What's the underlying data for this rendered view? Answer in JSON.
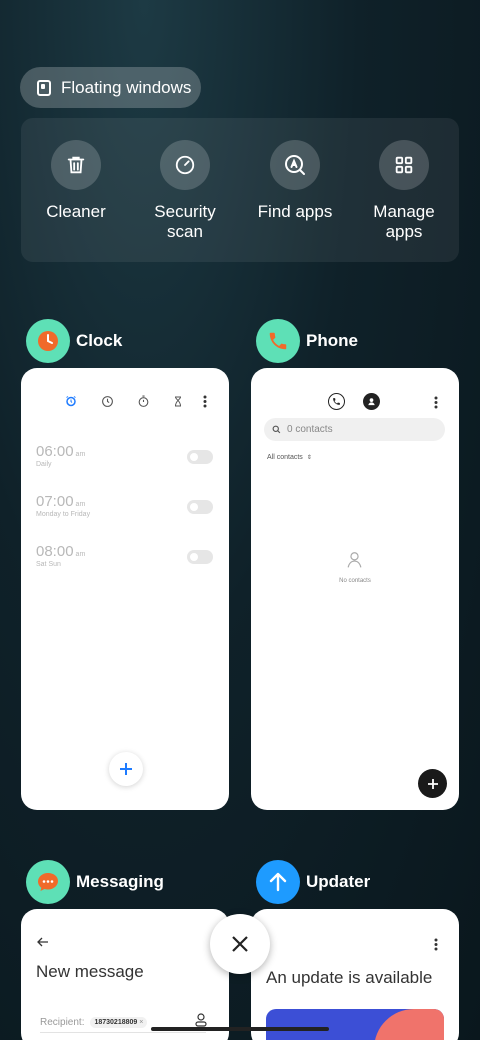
{
  "floating_windows": {
    "label": "Floating windows"
  },
  "quick_actions": [
    {
      "label": "Cleaner",
      "icon": "trash-icon"
    },
    {
      "label": "Security scan",
      "icon": "gauge-icon"
    },
    {
      "label": "Find apps",
      "icon": "find-apps-icon"
    },
    {
      "label": "Manage apps",
      "icon": "grid-icon"
    }
  ],
  "apps": {
    "clock": {
      "name": "Clock",
      "icon_color": "#5ee0b6",
      "alarms": [
        {
          "time": "06:00",
          "ampm": "am",
          "repeat": "Daily"
        },
        {
          "time": "07:00",
          "ampm": "am",
          "repeat": "Monday to Friday"
        },
        {
          "time": "08:00",
          "ampm": "am",
          "repeat": "Sat Sun"
        }
      ]
    },
    "phone": {
      "name": "Phone",
      "icon_color": "#5ee0b6",
      "search_placeholder": "0 contacts",
      "filter": "All contacts",
      "empty_text": "No contacts"
    },
    "messaging": {
      "name": "Messaging",
      "icon_color": "#5ee0b6",
      "title": "New message",
      "recipient_label": "Recipient:",
      "recipient_chip": "18730218809"
    },
    "updater": {
      "name": "Updater",
      "icon_color": "#1e9bff",
      "headline": "An update is available"
    }
  }
}
